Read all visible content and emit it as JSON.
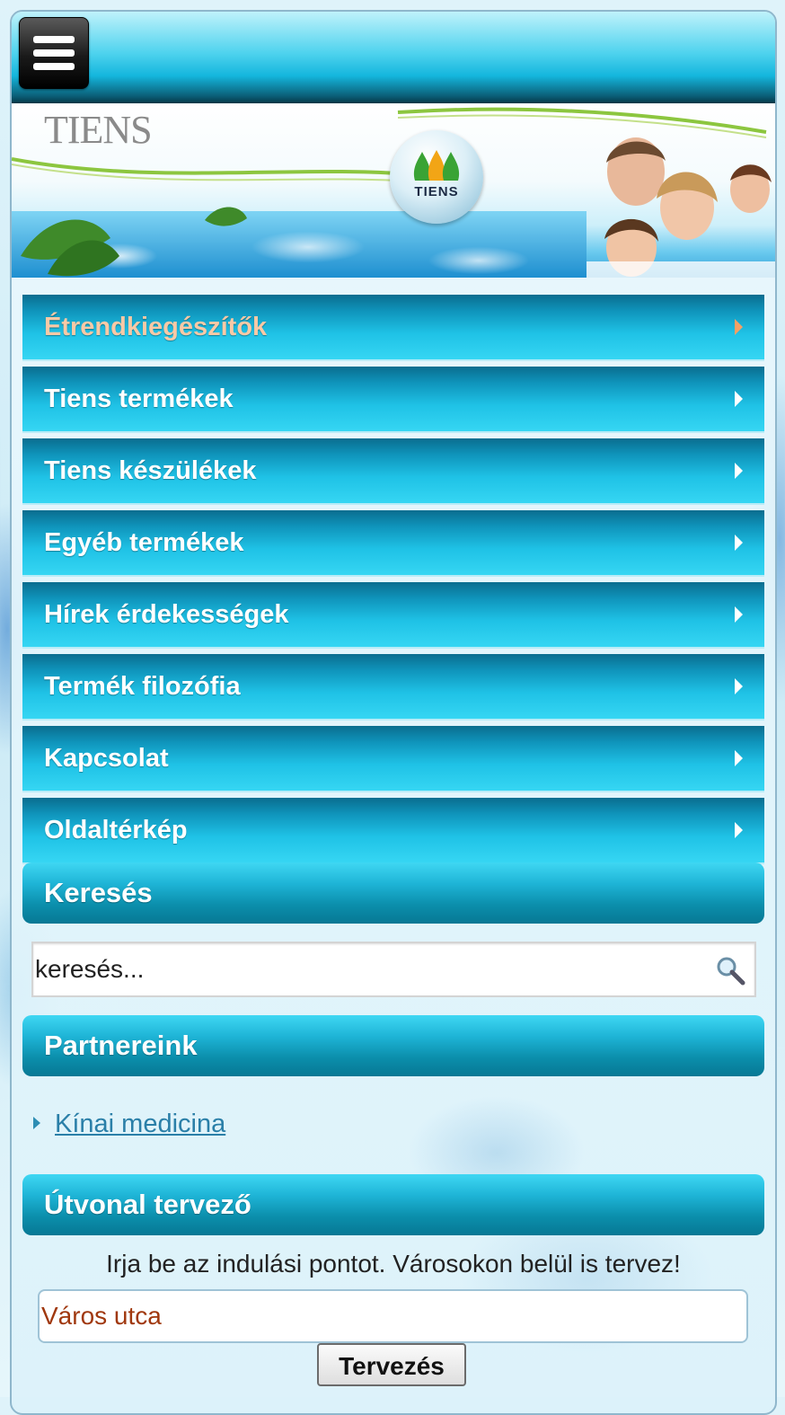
{
  "header": {
    "menu_button": "hamburger-menu-icon"
  },
  "banner": {
    "brand_text": "TIENS",
    "logo_text": "TIENS"
  },
  "nav": {
    "items": [
      {
        "label": "Étrendkiegészítők",
        "active": true
      },
      {
        "label": "Tiens termékek"
      },
      {
        "label": "Tiens készülékek"
      },
      {
        "label": "Egyéb termékek"
      },
      {
        "label": "Hírek érdekességek"
      },
      {
        "label": "Termék filozófia"
      },
      {
        "label": "Kapcsolat"
      },
      {
        "label": "Oldaltérkép"
      }
    ]
  },
  "search": {
    "title": "Keresés",
    "placeholder": "keresés..."
  },
  "partners": {
    "title": "Partnereink",
    "links": [
      {
        "label": "Kínai medicina"
      }
    ]
  },
  "route": {
    "title": "Útvonal tervező",
    "instruction": "Irja be az indulási pontot. Városokon belül is tervez!",
    "input_value": "Város utca",
    "button_label": "Tervezés"
  },
  "colors": {
    "nav_blue": "#1fc2e6",
    "active_label": "#f8c9a6",
    "active_arrow": "#f4a064",
    "link": "#2a7fa8"
  }
}
